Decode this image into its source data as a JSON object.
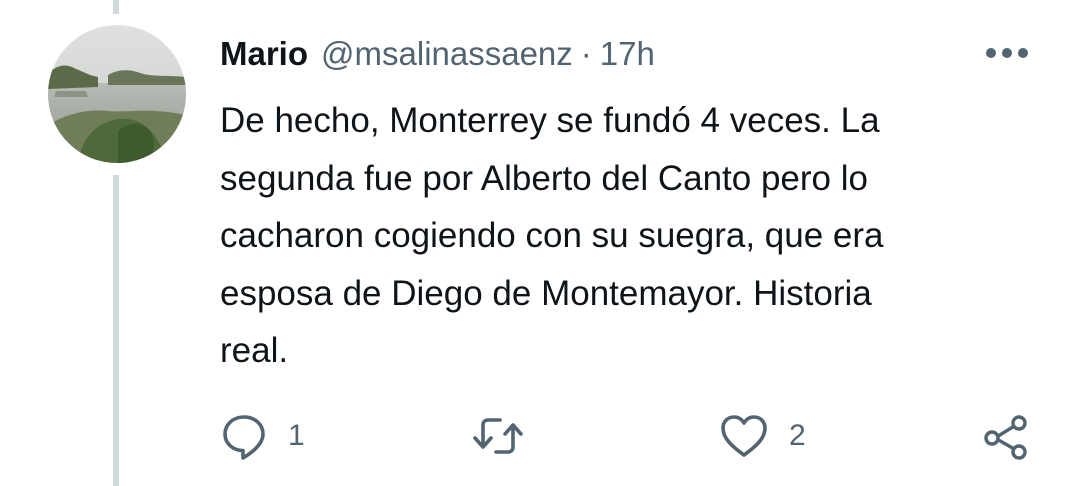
{
  "tweet": {
    "author_name": "Mario",
    "handle": "@msalinassaenz",
    "separator": "·",
    "time": "17h",
    "text_lines": [
      "De hecho, Monterrey se fundó 4 veces. La",
      "segunda fue por Alberto del Canto pero lo",
      "cacharon cogiendo con su suegra, que era",
      "esposa de Diego de Montemayor. Historia",
      "real."
    ]
  },
  "actions": {
    "reply_count": "1",
    "retweet_count": "",
    "like_count": "2"
  },
  "icons": {
    "more": "more-horizontal-icon",
    "reply": "reply-icon",
    "retweet": "retweet-icon",
    "like": "heart-icon",
    "share": "share-icon"
  },
  "colors": {
    "text": "#0f1419",
    "secondary": "#536471",
    "thread_line": "#cfd9de"
  }
}
